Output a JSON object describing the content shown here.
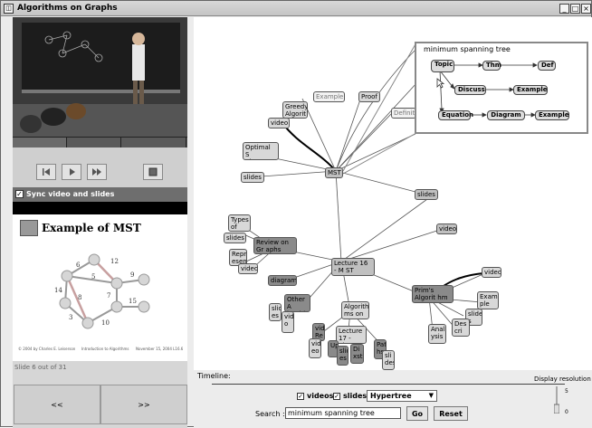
{
  "window": {
    "title": "Algorithms on Graphs",
    "minimize": "_",
    "maximize": "□",
    "close": "×"
  },
  "video_controls": {
    "prev_icon": "skip-back-icon",
    "play_icon": "play-icon",
    "ff_icon": "fast-forward-icon",
    "stop_icon": "stop-icon"
  },
  "sync": {
    "checked": "✓",
    "label": "Sync video and slides"
  },
  "slide": {
    "title": "Example of MST",
    "edge_weights": [
      "6",
      "12",
      "5",
      "9",
      "14",
      "8",
      "7",
      "15",
      "3",
      "10"
    ],
    "footer_left": "© 2004 by Charles E. Leiserson",
    "footer_mid": "Introduction to Algorithms",
    "footer_right": "November 15, 2004    L16.6",
    "count": "Slide 6 out of 31"
  },
  "nav": {
    "prev": "<<",
    "next": ">>"
  },
  "graph": {
    "nodes": {
      "example_top": "Example",
      "proof": "Proof",
      "definition": "Definiti",
      "greedy": "Greedy Algorit",
      "video1": "video",
      "optimal": "Optimal S ubstructu",
      "slides1": "slides",
      "mst": "MST",
      "slides2": "slides",
      "video2": "video",
      "types": "Types of Gra",
      "slides3": "slides",
      "review": "Review on Gr aphs",
      "repr": "Repr esen",
      "video3": "video",
      "lecture16": "Lecture 16 - M ST",
      "diagram": "diagram",
      "prims": "Prim's Algorit hm",
      "video4": "video",
      "other": "Other A lgorith",
      "slides4": "slid es",
      "video5": "vide o",
      "algos": "Algorith ms on Gr",
      "example2": "Exam ple",
      "slides5": "slide s",
      "desc": "Des cri",
      "analysis": "Anal ysis",
      "vid_re": "vid Re",
      "video6": "vid eo",
      "lecture17": "Lecture 17 - Sho",
      "up": "Up",
      "slides6": "slid es",
      "dist": "Di xst",
      "pat": "Pat hs",
      "slides7": "sli des"
    },
    "inset": {
      "title": "minimum spanning tree",
      "topic": "Topic",
      "thm": "Thm",
      "def": "Def",
      "discuss": "Discuss",
      "example1": "Example",
      "equation": "Equation",
      "diagram": "Diagram",
      "example2": "Example"
    }
  },
  "bottom": {
    "timeline_label": "Timeline:",
    "videos_checked": "✓",
    "videos_label": "videos",
    "slides_checked": "✓",
    "slides_label": "slides",
    "layout_value": "Hypertree",
    "search_label": "Search :",
    "search_value": "minimum spanning tree",
    "go": "Go",
    "reset": "Reset",
    "resolution_label": "Display resolution",
    "res_max": "5",
    "res_min": "0"
  }
}
